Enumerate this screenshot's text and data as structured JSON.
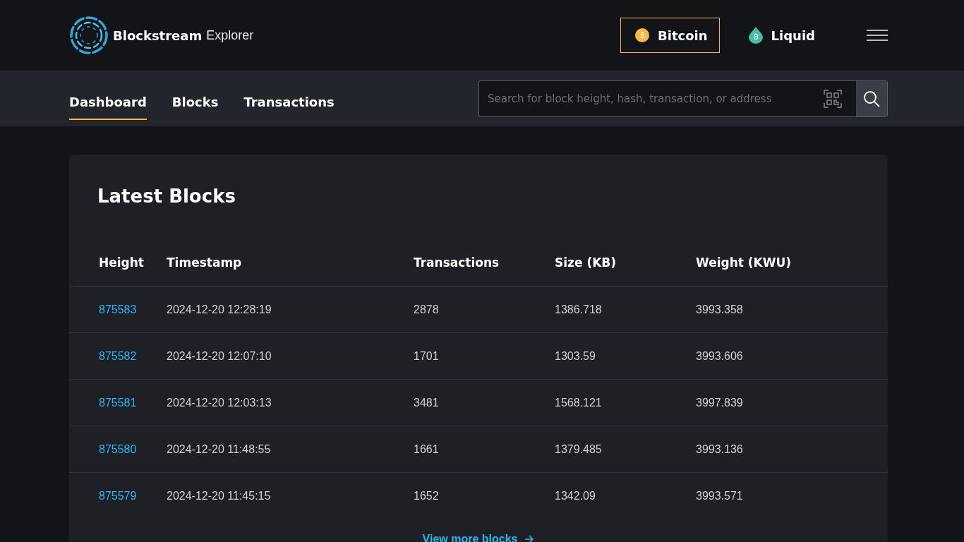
{
  "brand": {
    "name": "Blockstream",
    "product": "Explorer"
  },
  "networks": [
    {
      "label": "Bitcoin",
      "kind": "bitcoin",
      "selected": true
    },
    {
      "label": "Liquid",
      "kind": "liquid",
      "selected": false
    }
  ],
  "tabs": [
    {
      "label": "Dashboard",
      "selected": true
    },
    {
      "label": "Blocks",
      "selected": false
    },
    {
      "label": "Transactions",
      "selected": false
    }
  ],
  "search": {
    "placeholder": "Search for block height, hash, transaction, or address"
  },
  "latest_blocks": {
    "title": "Latest Blocks",
    "columns": [
      "Height",
      "Timestamp",
      "Transactions",
      "Size (KB)",
      "Weight (KWU)"
    ],
    "rows": [
      [
        "875583",
        "2024-12-20 12:28:19",
        "2878",
        "1386.718",
        "3993.358"
      ],
      [
        "875582",
        "2024-12-20 12:07:10",
        "1701",
        "1303.59",
        "3993.606"
      ],
      [
        "875581",
        "2024-12-20 12:03:13",
        "3481",
        "1568.121",
        "3997.839"
      ],
      [
        "875580",
        "2024-12-20 11:48:55",
        "1661",
        "1379.485",
        "3993.136"
      ],
      [
        "875579",
        "2024-12-20 11:45:15",
        "1652",
        "1342.09",
        "3993.571"
      ]
    ],
    "more_link": "View more blocks"
  }
}
